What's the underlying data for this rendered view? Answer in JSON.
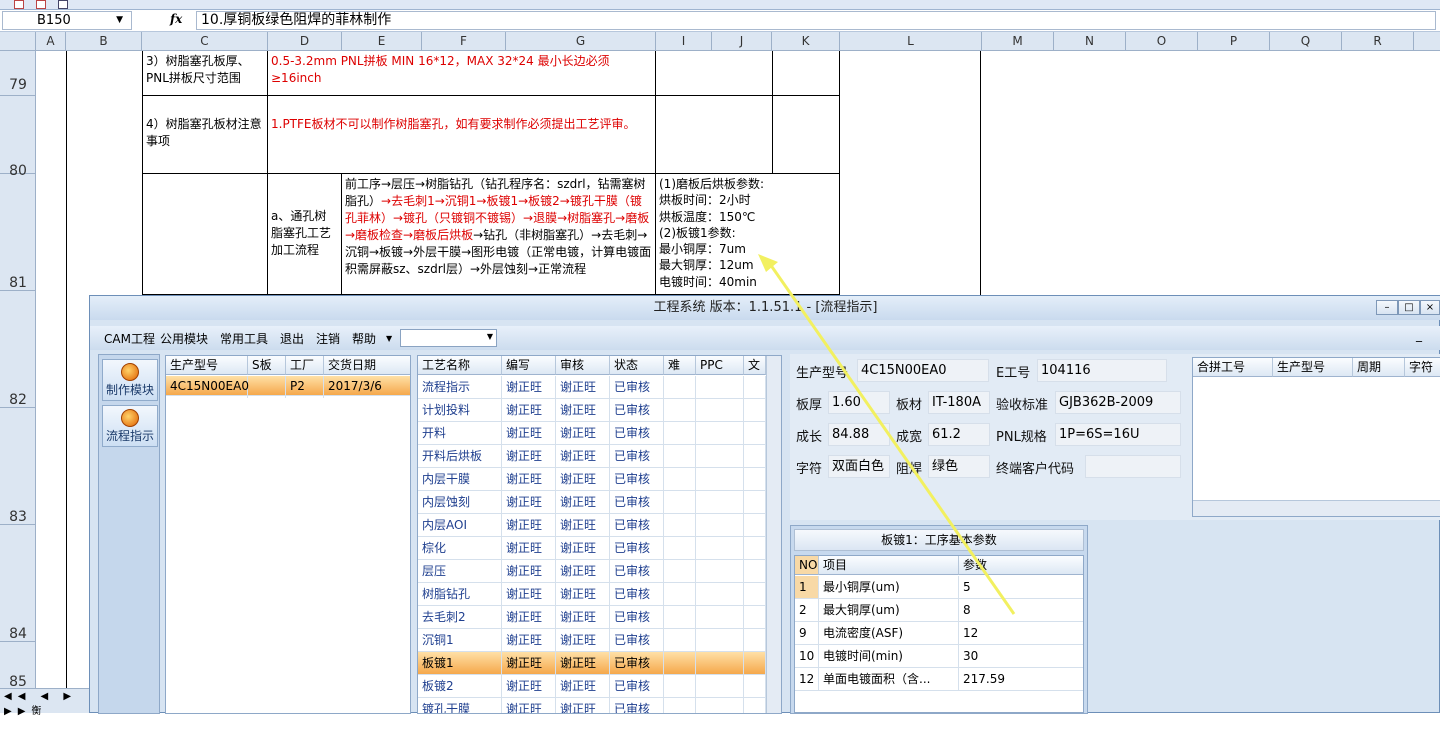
{
  "formula_bar": {
    "cell_ref": "B150",
    "fx": "fx",
    "content": "10.厚铜板绿色阻焊的菲林制作"
  },
  "columns": [
    "A",
    "B",
    "C",
    "D",
    "E",
    "F",
    "G",
    "I",
    "J",
    "K",
    "L",
    "M",
    "N",
    "O",
    "P",
    "Q",
    "R"
  ],
  "rows": [
    "79",
    "80",
    "81",
    "82",
    "83",
    "84",
    "85"
  ],
  "sheet": {
    "r79_c": "3）树脂塞孔板厚、PNL拼板尺寸范围",
    "r79_d": "0.5-3.2mm  PNL拼板  MIN 16*12，MAX 32*24 最小长边必须≥16inch",
    "r80_c": "4）树脂塞孔板材注意事项",
    "r80_d": "1.PTFE板材不可以制作树脂塞孔，如有要求制作必须提出工艺评审。",
    "r81_d": "a、通孔树脂塞孔工艺加工流程",
    "r81_e_black1": "前工序→层压→树脂钻孔（钻孔程序名：szdrl，钻需塞树脂孔）",
    "r81_e_red": "→去毛刺1→沉铜1→板镀1→板镀2→镀孔干膜（镀孔菲林）→镀孔（只镀铜不镀锡）→退膜→树脂塞孔→磨板→磨板检查→磨板后烘板",
    "r81_e_black2": "→钻孔（非树脂塞孔）→去毛刺→沉铜→板镀→外层干膜→图形电镀（正常电镀，计算电镀面积需屏蔽sz、szdrl层）→外层蚀刻→正常流程",
    "r81_i": [
      "(1)磨板后烘板参数:",
      "烘板时间：2小时",
      "烘板温度：150℃",
      "(2)板镀1参数:",
      "最小铜厚：7um",
      "最大铜厚：12um",
      "电镀时间：40min"
    ]
  },
  "sheet_tab": "衡",
  "dialog": {
    "title": "工程系统  版本：1.1.51.1 - [流程指示]",
    "menu": [
      "CAM工程",
      "公用模块",
      "常用工具",
      "退出",
      "注销",
      "帮助"
    ],
    "left_buttons": [
      "制作模块",
      "流程指示"
    ],
    "orders": {
      "headers": [
        "生产型号",
        "S板",
        "工厂",
        "交货日期"
      ],
      "rows": [
        [
          "4C15N00EA0",
          "",
          "P2",
          "2017/3/6"
        ]
      ]
    },
    "process": {
      "headers": [
        "工艺名称",
        "编写",
        "审核",
        "状态",
        "难",
        "PPC",
        "文"
      ],
      "rows": [
        [
          "流程指示",
          "谢正旺",
          "谢正旺",
          "已审核"
        ],
        [
          "计划投料",
          "谢正旺",
          "谢正旺",
          "已审核"
        ],
        [
          "开料",
          "谢正旺",
          "谢正旺",
          "已审核"
        ],
        [
          "开料后烘板",
          "谢正旺",
          "谢正旺",
          "已审核"
        ],
        [
          "内层干膜",
          "谢正旺",
          "谢正旺",
          "已审核"
        ],
        [
          "内层蚀刻",
          "谢正旺",
          "谢正旺",
          "已审核"
        ],
        [
          "内层AOI",
          "谢正旺",
          "谢正旺",
          "已审核"
        ],
        [
          "棕化",
          "谢正旺",
          "谢正旺",
          "已审核"
        ],
        [
          "层压",
          "谢正旺",
          "谢正旺",
          "已审核"
        ],
        [
          "树脂钻孔",
          "谢正旺",
          "谢正旺",
          "已审核"
        ],
        [
          "去毛刺2",
          "谢正旺",
          "谢正旺",
          "已审核"
        ],
        [
          "沉铜1",
          "谢正旺",
          "谢正旺",
          "已审核"
        ],
        [
          "板镀1",
          "谢正旺",
          "谢正旺",
          "已审核"
        ],
        [
          "板镀2",
          "谢正旺",
          "谢正旺",
          "已审核"
        ],
        [
          "镀孔干膜",
          "谢正旺",
          "谢正旺",
          "已审核"
        ]
      ],
      "selected": 12
    },
    "detail": {
      "prod_no_label": "生产型号",
      "prod_no": "4C15N00EA0",
      "e_no_label": "E工号",
      "e_no": "104116",
      "thick_label": "板厚",
      "thick": "1.60",
      "material_label": "板材",
      "material": "IT-180A",
      "std_label": "验收标准",
      "std": "GJB362B-2009",
      "len_label": "成长",
      "len": "84.88",
      "wid_label": "成宽",
      "wid": "61.2",
      "pnl_label": "PNL规格",
      "pnl": "1P=6S=16U",
      "char_label": "字符",
      "char": "双面白色",
      "mask_label": "阻焊",
      "mask": "绿色",
      "cust_label": "终端客户代码",
      "cust": ""
    },
    "panel_headers": [
      "合拼工号",
      "生产型号",
      "周期",
      "字符"
    ],
    "params": {
      "caption": "板镀1：工序基本参数",
      "headers": [
        "NO",
        "项目",
        "参数"
      ],
      "rows": [
        [
          "1",
          "最小铜厚(um)",
          "5"
        ],
        [
          "2",
          "最大铜厚(um)",
          "8"
        ],
        [
          "9",
          "电流密度(ASF)",
          "12"
        ],
        [
          "10",
          "电镀时间(min)",
          "30"
        ],
        [
          "12",
          "单面电镀面积（含...",
          "217.59"
        ]
      ]
    }
  }
}
